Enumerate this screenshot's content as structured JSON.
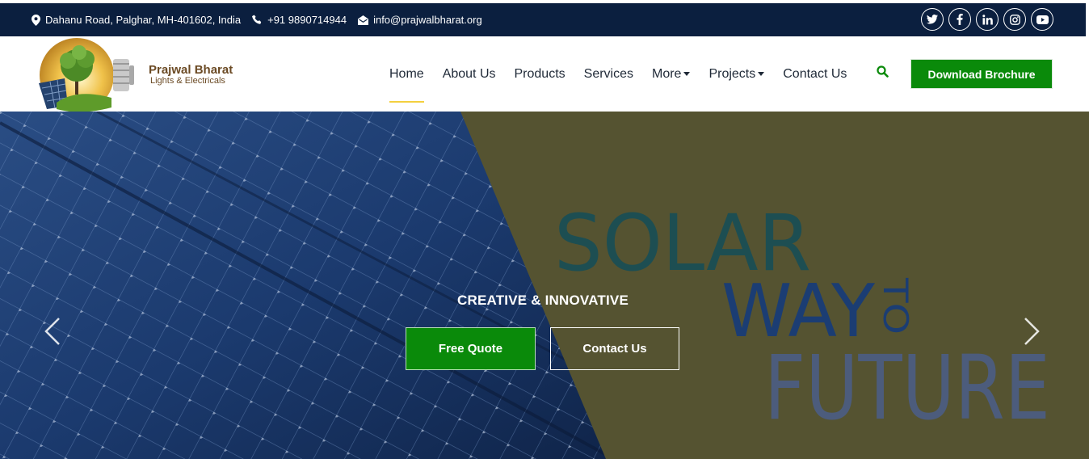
{
  "topbar": {
    "address": "Dahanu Road, Palghar, MH-401602, India",
    "phone": "+91 9890714944",
    "email": "info@prajwalbharat.org",
    "socials": [
      "twitter-icon",
      "facebook-icon",
      "linkedin-icon",
      "instagram-icon",
      "youtube-icon"
    ]
  },
  "brand": {
    "name": "Prajwal Bharat",
    "tagline": "Lights & Electricals"
  },
  "nav": {
    "items": [
      {
        "label": "Home",
        "active": true
      },
      {
        "label": "About Us"
      },
      {
        "label": "Products"
      },
      {
        "label": "Services"
      },
      {
        "label": "More",
        "dropdown": true
      },
      {
        "label": "Projects",
        "dropdown": true
      },
      {
        "label": "Contact Us"
      }
    ],
    "cta": "Download Brochure"
  },
  "hero": {
    "headline_words": [
      "SOLAR",
      "WAY",
      "TO",
      "FUTURE"
    ],
    "subtitle": "CREATIVE & INNOVATIVE",
    "buttons": {
      "primary": "Free Quote",
      "secondary": "Contact Us"
    }
  },
  "colors": {
    "topbar": "#0b1f3f",
    "accent_green": "#0a8a0a",
    "hero_olive": "#555331",
    "panel_blue": "#1b3f78"
  }
}
